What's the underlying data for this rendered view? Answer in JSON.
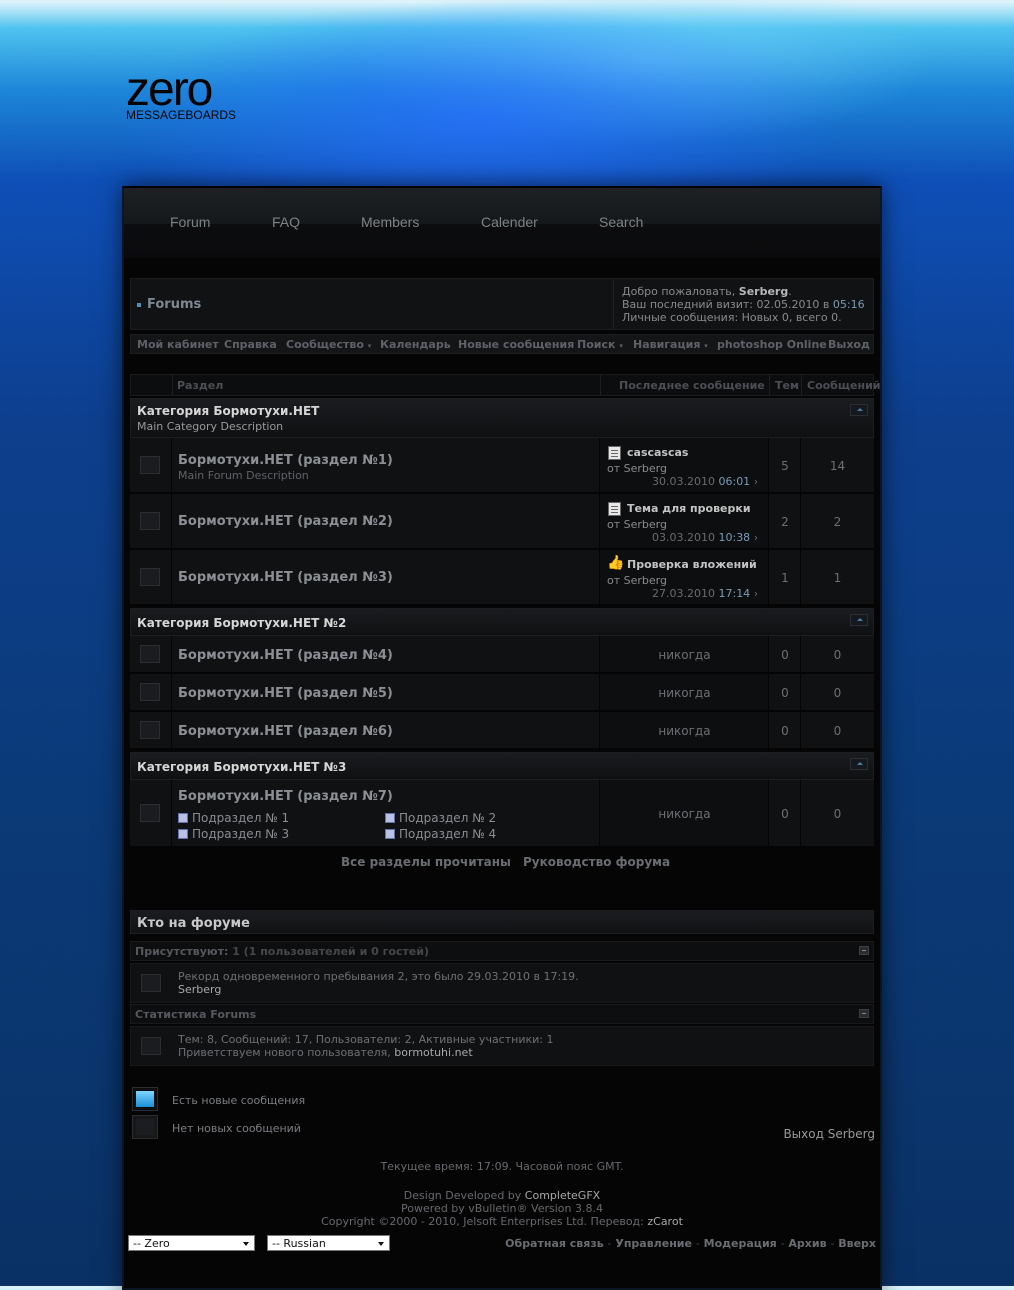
{
  "logo": {
    "word": "zero",
    "sub": "MESSAGEBOARDS"
  },
  "topnav": [
    "Forum",
    "FAQ",
    "Members",
    "Calender",
    "Search"
  ],
  "header": {
    "title": "Forums",
    "welcome_prefix": "Добро пожаловать,",
    "username": "Serberg",
    "last_visit_label": "Ваш последний визит:",
    "last_visit_date": "02.05.2010 в",
    "last_visit_time": "05:16",
    "pm_label": "Личные сообщения:",
    "pm_value": "Новых 0, всего 0."
  },
  "navbar": [
    "Мой кабинет",
    "Справка",
    "Сообщество",
    "Календарь",
    "Новые сообщения",
    "Поиск",
    "Навигация",
    "photoshop Online",
    "Выход"
  ],
  "table_header": {
    "forum": "Раздел",
    "last_post": "Последнее сообщение",
    "threads": "Тем",
    "posts": "Сообщений"
  },
  "categories": [
    {
      "title": "Категория Бормотухи.НЕТ",
      "description": "Main Category Description",
      "forums": [
        {
          "name": "Бормотухи.НЕТ (раздел №1)",
          "desc": "Main Forum Description",
          "lp_title": "cascascas",
          "lp_by": "от Serberg",
          "lp_date": "30.03.2010",
          "lp_time": "06:01",
          "threads": "5",
          "posts": "14"
        },
        {
          "name": "Бормотухи.НЕТ (раздел №2)",
          "lp_title": "Тема для проверки",
          "lp_by": "от Serberg",
          "lp_date": "03.03.2010",
          "lp_time": "10:38",
          "threads": "2",
          "posts": "2"
        },
        {
          "name": "Бормотухи.НЕТ (раздел №3)",
          "lp_title": "Проверка вложений",
          "lp_by": "от Serberg",
          "lp_date": "27.03.2010",
          "lp_time": "17:14",
          "threads": "1",
          "posts": "1"
        }
      ]
    },
    {
      "title": "Категория Бормотухи.НЕТ №2",
      "forums": [
        {
          "name": "Бормотухи.НЕТ (раздел №4)",
          "never": "никогда",
          "threads": "0",
          "posts": "0"
        },
        {
          "name": "Бормотухи.НЕТ (раздел №5)",
          "never": "никогда",
          "threads": "0",
          "posts": "0"
        },
        {
          "name": "Бормотухи.НЕТ (раздел №6)",
          "never": "никогда",
          "threads": "0",
          "posts": "0"
        }
      ]
    },
    {
      "title": "Категория Бормотухи.НЕТ №3",
      "forums": [
        {
          "name": "Бормотухи.НЕТ (раздел №7)",
          "never": "никогда",
          "threads": "0",
          "posts": "0",
          "subforums": [
            "Подраздел № 1",
            "Подраздел № 2",
            "Подраздел № 3",
            "Подраздел № 4"
          ]
        }
      ]
    }
  ],
  "forum_links": [
    "Все разделы прочитаны",
    "Руководство форума"
  ],
  "whos_online": {
    "title": "Кто на форуме",
    "present_label": "Присутствуют:",
    "present_value": "1 (1 пользователей и 0 гостей)",
    "record_text": "Рекорд одновременного пребывания 2, это было 29.03.2010 в 17:19.",
    "online_user": "Serberg",
    "stats_label": "Статистика Forums",
    "stats_text": "Тем: 8, Сообщений: 17, Пользователи: 2, Активные участники: 1",
    "welcome_new_prefix": "Приветствуем нового пользователя,",
    "welcome_new_user": "bormotuhi.net"
  },
  "legend": {
    "new": "Есть новые сообщения",
    "no_new": "Нет новых сообщений"
  },
  "logout": "Выход Serberg",
  "footer": {
    "time": "Текущее время: 17:09. Часовой пояс GMT.",
    "design_prefix": "Design Developed by",
    "design_by": "CompleteGFX",
    "powered": "Powered by vBulletin® Version 3.8.4",
    "copyright_prefix": "Copyright ©2000 - 2010, Jelsoft Enterprises Ltd. Перевод:",
    "translator": "zCarot",
    "style_select": "-- Zero",
    "lang_select": "-- Russian",
    "links": [
      "Обратная связь",
      "Управление",
      "Модерация",
      "Архив",
      "Вверх"
    ]
  },
  "colors": {
    "accent": "#7a9ab8",
    "background_top": "#4fc3ef",
    "background_bottom": "#0a3165",
    "panel": "#050505"
  }
}
